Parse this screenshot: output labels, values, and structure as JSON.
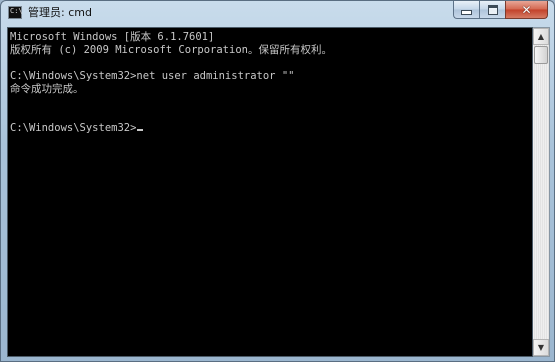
{
  "window": {
    "title": "管理员: cmd",
    "app_icon_glyph": "C:\\",
    "controls": {
      "minimize_icon": "minimize-icon",
      "maximize_icon": "maximize-icon",
      "close_glyph": "✕"
    }
  },
  "console": {
    "lines": [
      "Microsoft Windows [版本 6.1.7601]",
      "版权所有 (c) 2009 Microsoft Corporation。保留所有权利。",
      "",
      "C:\\Windows\\System32>net user administrator \"\"",
      "命令成功完成。",
      "",
      "",
      "C:\\Windows\\System32>"
    ],
    "text_color": "#c0c0c0",
    "background_color": "#000000"
  },
  "scrollbar": {
    "up_arrow": "▲",
    "down_arrow": "▼"
  },
  "colors": {
    "titlebar": "#a9c3da",
    "close_button": "#c2412a"
  }
}
